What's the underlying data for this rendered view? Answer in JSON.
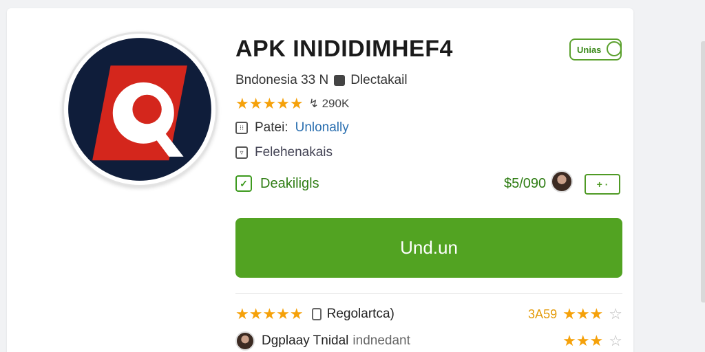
{
  "app": {
    "title": "APK INIDIDIMHEF4",
    "badge": "Unias",
    "meta_left": "Bndonesia  33 N",
    "meta_right": "Dlectakail",
    "rating_stars": "★★★★★",
    "rating_count": "↯ 290K",
    "info1_label": "Patei:",
    "info1_value": "Unlonally",
    "info2_value": "Felehenakais",
    "status_label": "Deakiligls",
    "price": "$5/090",
    "plus_label": "+ ·",
    "download_label": "Und.un"
  },
  "reviews": [
    {
      "stars": "★★★★★",
      "text": "Regolartca)",
      "score": "3A59",
      "score_stars": "★★★",
      "grey_stars": "☆",
      "name": ""
    },
    {
      "stars": "",
      "text": "Dgplaay  Tnidal",
      "sub": "indnedant",
      "score": "",
      "score_stars": "★★★",
      "grey_stars": "☆",
      "name": ""
    }
  ],
  "colors": {
    "accent": "#52a322",
    "star": "#f5a10a",
    "link": "#2a6fb0",
    "icon_bg": "#0f1d3a",
    "icon_red": "#d4261c"
  }
}
